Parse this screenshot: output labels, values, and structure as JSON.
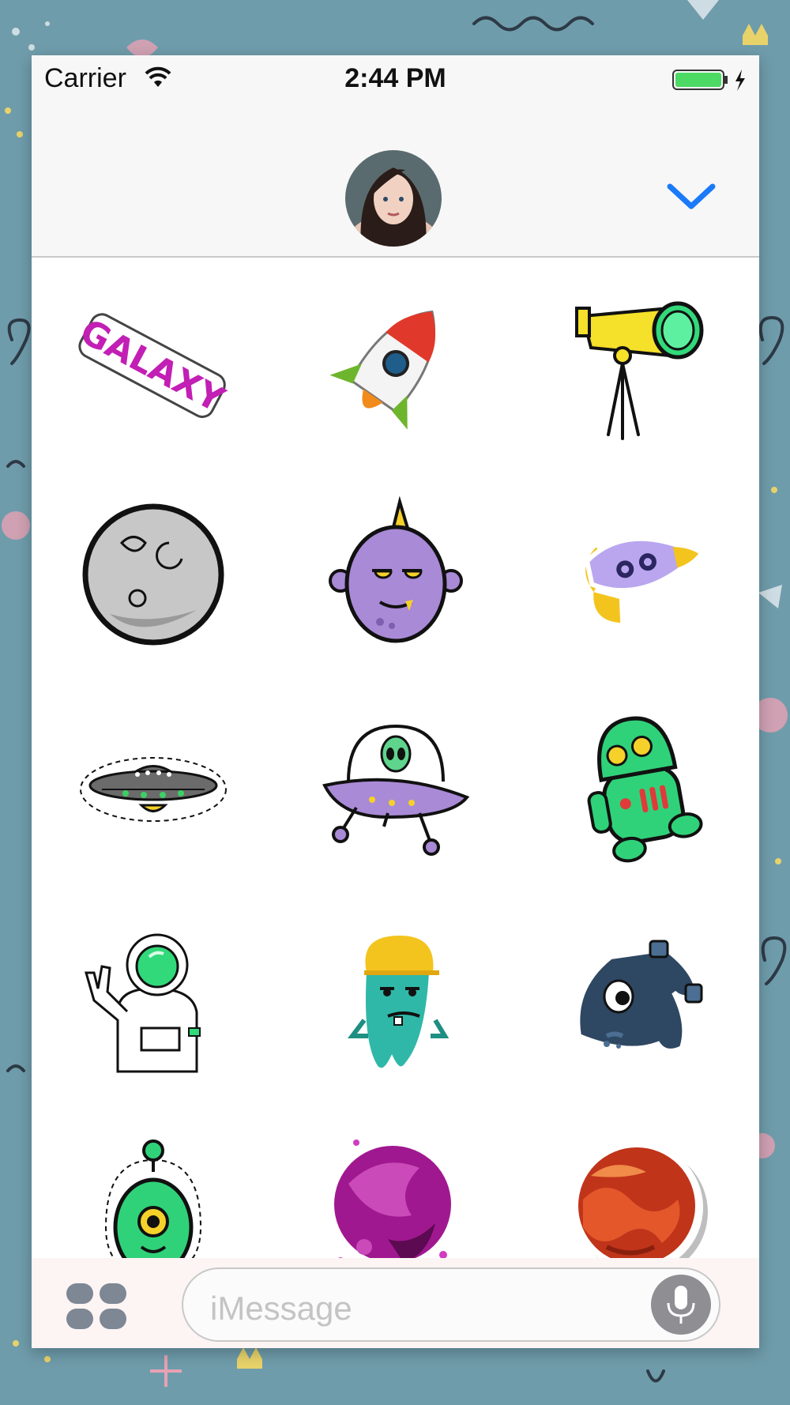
{
  "status_bar": {
    "carrier": "Carrier",
    "time": "2:44 PM"
  },
  "header": {
    "avatar": "contact-avatar",
    "collapse_icon": "chevron-down-icon"
  },
  "stickers": [
    {
      "name": "galaxy-text",
      "label": "GALAXY"
    },
    {
      "name": "rocket"
    },
    {
      "name": "telescope"
    },
    {
      "name": "moon"
    },
    {
      "name": "purple-monster"
    },
    {
      "name": "purple-rocket"
    },
    {
      "name": "gray-ufo"
    },
    {
      "name": "alien-ufo"
    },
    {
      "name": "green-robot"
    },
    {
      "name": "astronaut"
    },
    {
      "name": "teal-monster"
    },
    {
      "name": "navy-monster"
    },
    {
      "name": "green-alien"
    },
    {
      "name": "magenta-planet"
    },
    {
      "name": "orange-planet"
    }
  ],
  "input_bar": {
    "placeholder": "iMessage",
    "apps_icon": "app-drawer-icon",
    "mic_icon": "microphone-icon"
  },
  "colors": {
    "background": "#6f9cab",
    "accent": "#1a7af8",
    "battery": "#4cd964"
  }
}
